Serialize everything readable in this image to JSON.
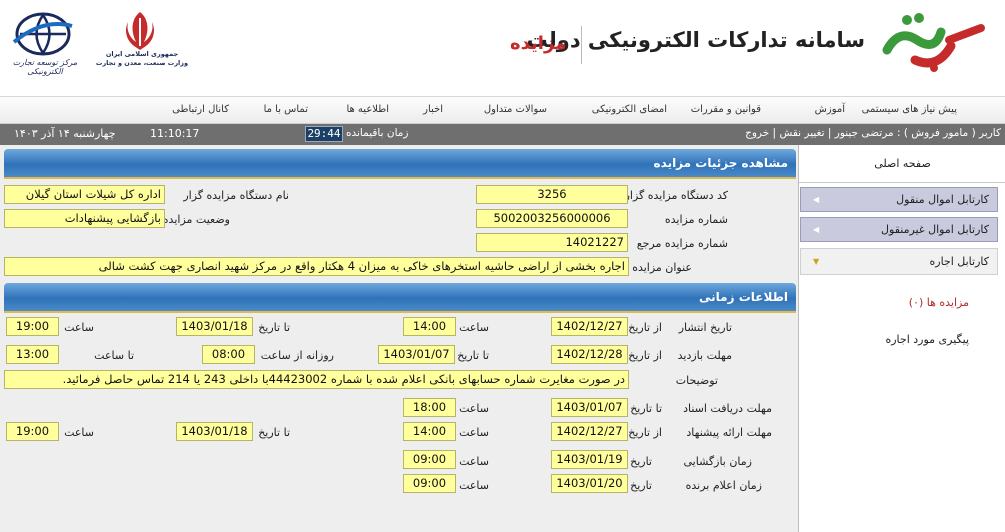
{
  "header": {
    "title": "سامانه تدارکات الکترونیکی دولت",
    "subtitle": "مزایده",
    "ministry_line1": "جمهوری اسلامی ایران",
    "ministry_line2": "وزارت صنعت، معدن و تجارت",
    "center_name": "مرکز توسعه تجارت الکترونیکی"
  },
  "topnav": {
    "items": [
      "پیش نیاز های سیستمی",
      "آموزش",
      "قوانین و مقررات",
      "امضای الکترونیکی",
      "سوالات متداول",
      "اخبار",
      "اطلاعیه ها",
      "تماس با ما",
      "کانال ارتباطی"
    ]
  },
  "status": {
    "user": "کاربر ( مامور فروش ) : مرتضی جینور",
    "change_role": "تغییر نقش",
    "logout": "خروج",
    "remaining_label": "زمان باقیمانده",
    "timer": "29:44",
    "clock": "11:10:17",
    "date": "چهارشنبه ۱۴ آذر ۱۴۰۳"
  },
  "sidebar": {
    "home": "صفحه اصلی",
    "movable": "کارتابل اموال منقول",
    "immovable": "کارتابل اموال غیرمنقول",
    "rental": "کارتابل اجاره",
    "auctions": "مزایده ها (۰)",
    "followup": "پیگیری مورد اجاره"
  },
  "details": {
    "header": "مشاهده جزئیات مزایده",
    "org_code_label": "کد دستگاه مزایده گزار",
    "org_code": "3256",
    "org_name_label": "نام دستگاه مزایده گزار",
    "org_name": "اداره کل شیلات استان گیلان",
    "auction_no_label": "شماره مزایده",
    "auction_no": "5002003256000006",
    "status_label": "وضعیت مزایده",
    "status": "بازگشایی پیشنهادات",
    "ref_no_label": "شماره مزایده مرجع",
    "ref_no": "14021227",
    "title_label": "عنوان مزایده",
    "title": "اجاره بخشی از اراضی حاشیه استخرهای خاکی به میزان 4 هکتار واقع در مرکز شهید انصاری جهت کشت شالی"
  },
  "timing": {
    "header": "اطلاعات زمانی",
    "publish_label": "تاریخ انتشار",
    "visit_label": "مهلت بازدید",
    "notes_label": "توضیحات",
    "doc_receive_label": "مهلت دریافت اسناد",
    "offer_label": "مهلت ارائه پیشنهاد",
    "opening_label": "زمان بازگشایی",
    "winner_label": "زمان اعلام برنده",
    "from_date": "از تاریخ",
    "to_date": "تا تاریخ",
    "date": "تاریخ",
    "time": "ساعت",
    "to_time": "تا ساعت",
    "daily_from_time": "روزانه از ساعت",
    "publish_from_date": "1402/12/27",
    "publish_from_time": "14:00",
    "publish_to_date": "1403/01/18",
    "publish_to_time": "19:00",
    "visit_from_date": "1402/12/28",
    "visit_to_date": "1403/01/07",
    "visit_daily_from": "08:00",
    "visit_daily_to": "13:00",
    "notes": "در صورت مغایرت شماره حسابهای بانکی اعلام شده با شماره 44423002با داخلی 243 یا 214 تماس حاصل فرمائید.",
    "doc_to_date": "1403/01/07",
    "doc_to_time": "18:00",
    "offer_from_date": "1402/12/27",
    "offer_from_time": "14:00",
    "offer_to_date": "1403/01/18",
    "offer_to_time": "19:00",
    "opening_date": "1403/01/19",
    "opening_time": "09:00",
    "winner_date": "1403/01/20",
    "winner_time": "09:00"
  },
  "colors": {
    "header_blue": "#2f72b8",
    "field_yellow": "#ffff9c",
    "brand_red": "#c62b2b",
    "brand_green": "#3c9a3c",
    "status_gray": "#6f6f6f",
    "sidebar_lavender": "#c9cade"
  }
}
